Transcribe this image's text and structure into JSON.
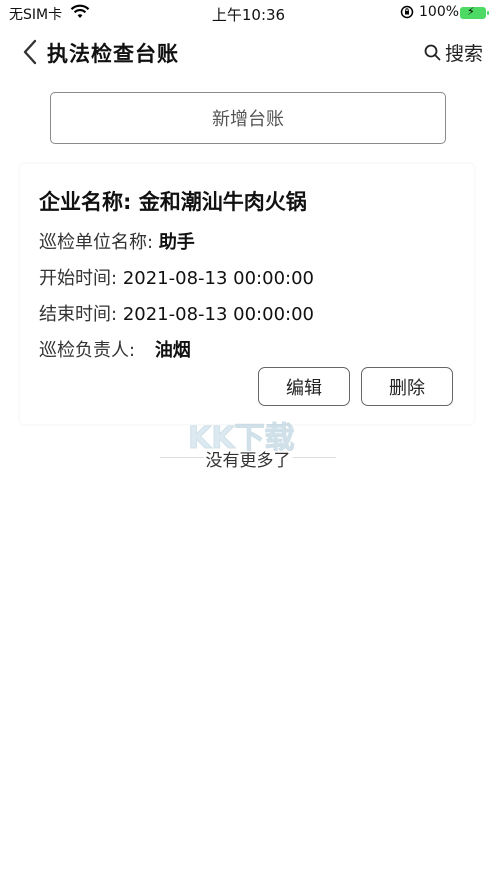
{
  "status_bar": {
    "carrier": "无SIM卡",
    "time": "上午10:36",
    "battery_pct": "100%",
    "battery_color": "#4cd964"
  },
  "nav": {
    "title": "执法检查台账",
    "back_icon": "chevron-left-icon",
    "search_label": "搜索",
    "search_icon": "search-icon"
  },
  "add_button": {
    "label": "新增台账"
  },
  "record": {
    "company_label": "企业名称:",
    "company_value": "金和潮汕牛肉火锅",
    "unit_label": "巡检单位名称:",
    "unit_value": "助手",
    "start_label": "开始时间:",
    "start_value": "2021-08-13 00:00:00",
    "end_label": "结束时间:",
    "end_value": "2021-08-13 00:00:00",
    "owner_label": "巡检负责人:",
    "owner_value": "油烟",
    "edit_label": "编辑",
    "delete_label": "删除"
  },
  "footer": {
    "text": "没有更多了"
  },
  "watermark": {
    "text": "KK下载"
  }
}
